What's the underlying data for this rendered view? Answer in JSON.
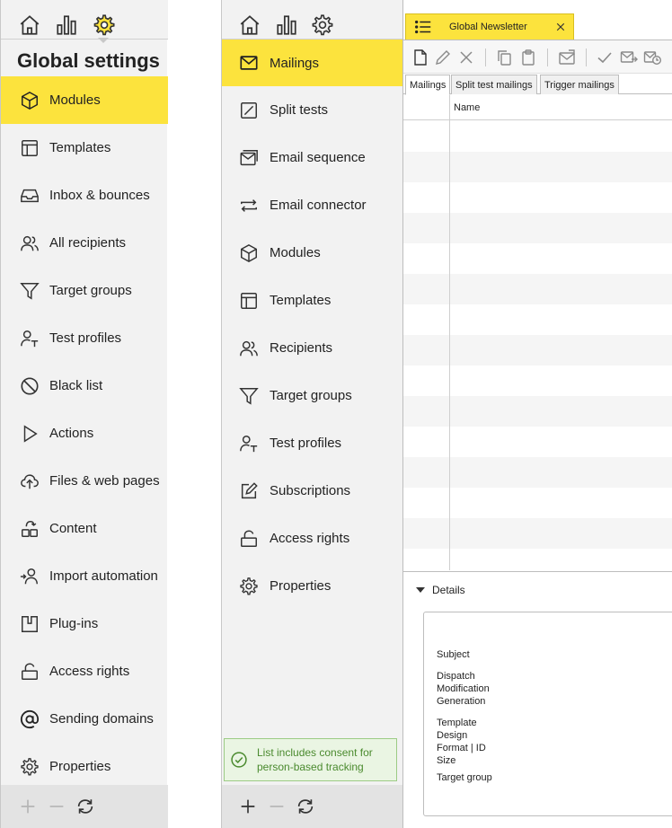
{
  "left_panel": {
    "title": "Global settings",
    "nav_icons": [
      "home-icon",
      "bar-chart-icon",
      "gear-icon"
    ],
    "items": [
      {
        "label": "Modules",
        "icon": "cube-icon",
        "active": true
      },
      {
        "label": "Templates",
        "icon": "template-icon",
        "active": false
      },
      {
        "label": "Inbox & bounces",
        "icon": "inbox-icon",
        "active": false
      },
      {
        "label": "All recipients",
        "icon": "users-icon",
        "active": false
      },
      {
        "label": "Target groups",
        "icon": "filter-icon",
        "active": false
      },
      {
        "label": "Test profiles",
        "icon": "test-profile-icon",
        "active": false
      },
      {
        "label": "Black list",
        "icon": "ban-icon",
        "active": false
      },
      {
        "label": "Actions",
        "icon": "play-icon",
        "active": false
      },
      {
        "label": "Files & web pages",
        "icon": "cloud-upload-icon",
        "active": false
      },
      {
        "label": "Content",
        "icon": "content-icon",
        "active": false
      },
      {
        "label": "Import automation",
        "icon": "import-user-icon",
        "active": false
      },
      {
        "label": "Plug-ins",
        "icon": "plugin-icon",
        "active": false
      },
      {
        "label": "Access rights",
        "icon": "unlock-icon",
        "active": false
      },
      {
        "label": "Sending domains",
        "icon": "at-icon",
        "active": false
      },
      {
        "label": "Properties",
        "icon": "gear-icon",
        "active": false
      }
    ]
  },
  "mid_panel": {
    "items": [
      {
        "label": "Mailings",
        "icon": "envelope-icon",
        "active": true
      },
      {
        "label": "Split tests",
        "icon": "split-test-icon",
        "active": false
      },
      {
        "label": "Email sequence",
        "icon": "email-sequence-icon",
        "active": false
      },
      {
        "label": "Email connector",
        "icon": "connector-arrows-icon",
        "active": false
      },
      {
        "label": "Modules",
        "icon": "cube-icon",
        "active": false
      },
      {
        "label": "Templates",
        "icon": "template-icon",
        "active": false
      },
      {
        "label": "Recipients",
        "icon": "users-icon",
        "active": false
      },
      {
        "label": "Target groups",
        "icon": "filter-icon",
        "active": false
      },
      {
        "label": "Test profiles",
        "icon": "test-profile-icon",
        "active": false
      },
      {
        "label": "Subscriptions",
        "icon": "edit-box-icon",
        "active": false
      },
      {
        "label": "Access rights",
        "icon": "unlock-icon",
        "active": false
      },
      {
        "label": "Properties",
        "icon": "gear-icon",
        "active": false
      }
    ],
    "consent_notice": "List includes consent for person-based tracking"
  },
  "right_panel": {
    "doc_tab": {
      "title": "Global Newsletter",
      "icon": "list-icon"
    },
    "subtabs": [
      "Mailings",
      "Split test mailings",
      "Trigger mailings"
    ],
    "grid": {
      "column_name": "Name"
    },
    "details": {
      "label": "Details",
      "fields": {
        "subject": "Subject",
        "dispatch": "Dispatch",
        "modification": "Modification",
        "generation": "Generation",
        "template": "Template",
        "design": "Design",
        "format_id": "Format | ID",
        "size": "Size",
        "target_group": "Target group"
      }
    }
  },
  "colors": {
    "accent": "#fce33d",
    "panel_bg": "#f2f2f2",
    "consent_bg": "#eaf5e3",
    "consent_text": "#4a8a2e"
  }
}
